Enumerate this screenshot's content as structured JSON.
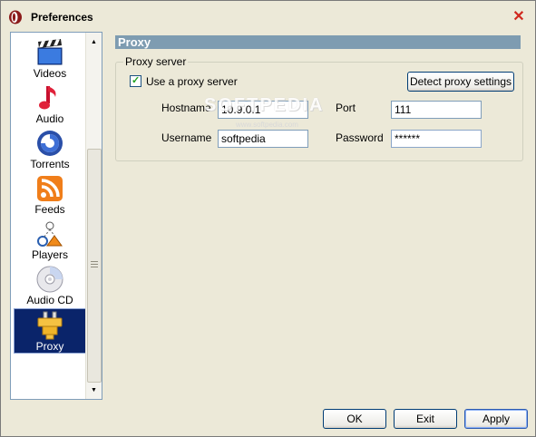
{
  "window": {
    "title": "Preferences"
  },
  "sidebar": {
    "items": [
      {
        "label": "Videos",
        "icon": "clapperboard-icon"
      },
      {
        "label": "Audio",
        "icon": "music-note-icon"
      },
      {
        "label": "Torrents",
        "icon": "torrent-swirl-icon"
      },
      {
        "label": "Feeds",
        "icon": "rss-feed-icon"
      },
      {
        "label": "Players",
        "icon": "players-icon"
      },
      {
        "label": "Audio CD",
        "icon": "cd-icon"
      },
      {
        "label": "Proxy",
        "icon": "plug-icon",
        "selected": true
      }
    ]
  },
  "proxy": {
    "header": "Proxy",
    "group_title": "Proxy server",
    "use_proxy_label": "Use a proxy server",
    "use_proxy_checked": true,
    "detect_button": "Detect proxy settings",
    "hostname_label": "Hostname",
    "hostname_value": "10.9.0.1",
    "port_label": "Port",
    "port_value": "111",
    "username_label": "Username",
    "username_value": "softpedia",
    "password_label": "Password",
    "password_value": "******"
  },
  "watermark": {
    "text": "SOFTPEDIA",
    "sub": "www.softpedia.com"
  },
  "footer": {
    "ok": "OK",
    "exit": "Exit",
    "apply": "Apply"
  },
  "colors": {
    "header_bg": "#7E9CB1",
    "selection": "#0A246A",
    "close": "#D0281E"
  }
}
